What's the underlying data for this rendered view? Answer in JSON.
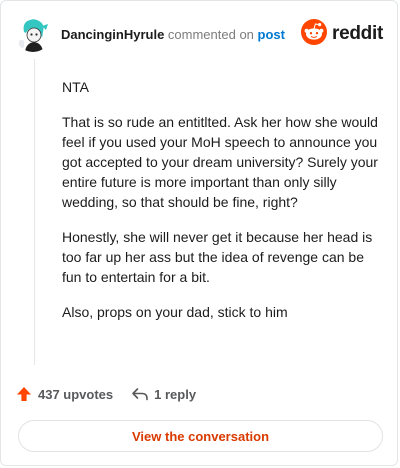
{
  "header": {
    "username": "DancinginHyrule",
    "action_text": "commented on",
    "post_link_text": "post",
    "brand_name": "reddit",
    "brand_color": "#ff4500"
  },
  "comment": {
    "paragraphs": [
      "NTA",
      "That is so rude an entitlted. Ask her how she would feel if you used your MoH speech to announce you got accepted to your dream university? Surely your entire future is more important than only silly wedding, so that should be fine, right?",
      "Honestly, she will never get it because her head is too far up her ass but the idea of revenge can be fun to entertain for a bit.",
      "Also, props on your dad, stick to him"
    ]
  },
  "actions": {
    "upvotes": "437 upvotes",
    "replies": "1 reply",
    "upvote_color": "#ff4500"
  },
  "footer": {
    "view_button_label": "View the conversation",
    "view_button_color": "#d93a00"
  }
}
